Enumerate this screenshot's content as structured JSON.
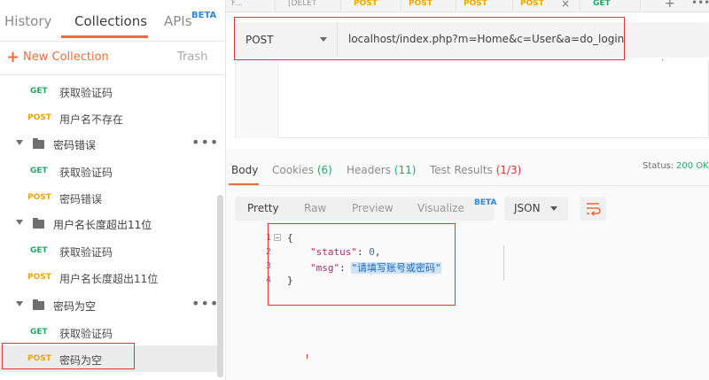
{
  "sidebar": {
    "tabs": [
      {
        "label": "History"
      },
      {
        "label": "Collections"
      },
      {
        "label": "APIs"
      }
    ],
    "apis_badge": "BETA",
    "new_collection_label": "New Collection",
    "trash_label": "Trash",
    "tree": [
      {
        "type": "request",
        "method": "GET",
        "name": "获取验证码"
      },
      {
        "type": "request",
        "method": "POST",
        "name": "用户名不存在"
      },
      {
        "type": "folder",
        "name": "密码错误"
      },
      {
        "type": "request",
        "method": "GET",
        "name": "获取验证码"
      },
      {
        "type": "request",
        "method": "POST",
        "name": "密码错误"
      },
      {
        "type": "folder",
        "name": "用户名长度超出11位"
      },
      {
        "type": "request",
        "method": "GET",
        "name": "获取验证码"
      },
      {
        "type": "request",
        "method": "POST",
        "name": "用户名长度超出11位"
      },
      {
        "type": "folder",
        "name": "密码为空"
      },
      {
        "type": "request",
        "method": "GET",
        "name": "获取验证码"
      },
      {
        "type": "request",
        "method": "POST",
        "name": "密码为空",
        "selected": true
      }
    ]
  },
  "request_tabs": [
    {
      "method": "",
      "label": "F..."
    },
    {
      "method": "",
      "label": "[DELET"
    },
    {
      "method": "POST",
      "label": "P"
    },
    {
      "method": "POST",
      "label": "P"
    },
    {
      "method": "POST",
      "label": "P"
    },
    {
      "method": "POST",
      "label": "P"
    },
    {
      "method": "GET",
      "label": "GET"
    }
  ],
  "request": {
    "method": "POST",
    "url": "localhost/index.php?m=Home&c=User&a=do_login"
  },
  "response": {
    "tabs": {
      "body": "Body",
      "cookies": "Cookies",
      "cookies_count": "(6)",
      "headers": "Headers",
      "headers_count": "(11)",
      "test_results": "Test Results",
      "test_results_count": "(1/3)"
    },
    "status_label": "Status:",
    "status_value": "200 OK",
    "view_modes": {
      "pretty": "Pretty",
      "raw": "Raw",
      "preview": "Preview",
      "visualize": "Visualize",
      "visualize_badge": "BETA"
    },
    "format": "JSON",
    "body_lines": [
      "1",
      "2",
      "3",
      "4"
    ],
    "json": {
      "open_brace": "{",
      "status_key": "\"status\"",
      "status_sep": ": ",
      "status_value": "0",
      "status_comma": ",",
      "msg_key": "\"msg\"",
      "msg_sep": ": ",
      "msg_value": "\"请填写账号或密码\"",
      "close_brace": "}"
    }
  },
  "colors": {
    "accent": "#ef6c3b",
    "get": "#23a867",
    "post": "#f0a500",
    "annotation": "#e03434",
    "beta": "#2d88d8"
  }
}
